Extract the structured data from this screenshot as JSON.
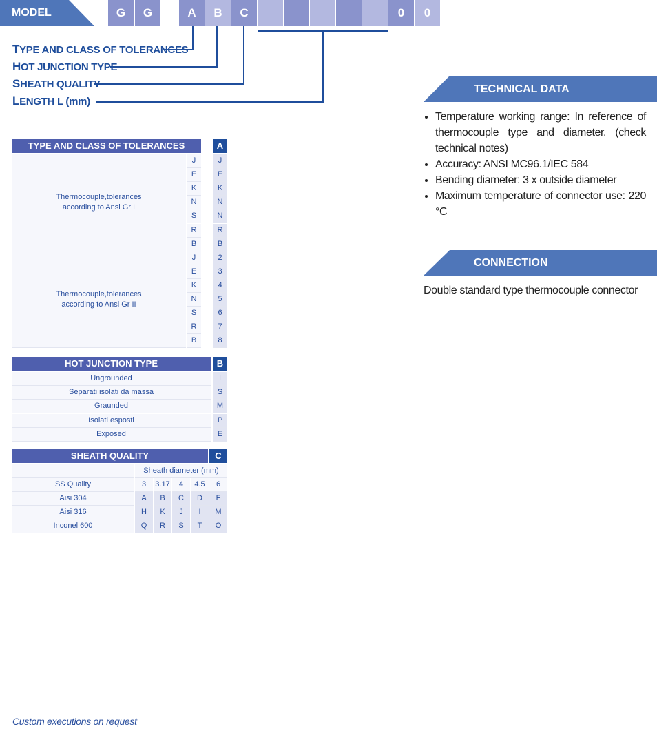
{
  "model": {
    "label": "MODEL",
    "boxes": [
      {
        "text": "G",
        "shade": "dark"
      },
      {
        "text": "G",
        "shade": "dark"
      },
      {
        "text": "A",
        "shade": "dark"
      },
      {
        "text": "B",
        "shade": "light"
      },
      {
        "text": "C",
        "shade": "dark"
      },
      {
        "text": "",
        "shade": "light"
      },
      {
        "text": "",
        "shade": "dark"
      },
      {
        "text": "",
        "shade": "light"
      },
      {
        "text": "",
        "shade": "dark"
      },
      {
        "text": "",
        "shade": "light"
      },
      {
        "text": "0",
        "shade": "dark"
      },
      {
        "text": "0",
        "shade": "light"
      }
    ],
    "legend": [
      {
        "first": "T",
        "rest": "YPE AND CLASS OF TOLERANCES"
      },
      {
        "first": "H",
        "rest": "OT JUNCTION TYPE"
      },
      {
        "first": "S",
        "rest": "HEATH QUALITY"
      },
      {
        "first": "L",
        "rest": "ENGTH L (mm)"
      }
    ]
  },
  "colors": {
    "banner": "#4f76b9",
    "header": "#4f5fae",
    "code_header": "#1f4e9c",
    "dark_box": "#8a93cc",
    "light_box": "#b3b8e0"
  },
  "table_a": {
    "title": "TYPE AND CLASS OF TOLERANCES",
    "code": "A",
    "groups": [
      {
        "label": "Thermocouple,tolerances\naccording to Ansi Gr I",
        "types": [
          "J",
          "E",
          "K",
          "N",
          "S",
          "R",
          "B"
        ],
        "codes": [
          "J",
          "E",
          "K",
          "N",
          "N",
          "R",
          "B"
        ]
      },
      {
        "label": "Thermocouple,tolerances\naccording to Ansi Gr II",
        "types": [
          "J",
          "E",
          "K",
          "N",
          "S",
          "R",
          "B"
        ],
        "codes": [
          "2",
          "3",
          "4",
          "5",
          "6",
          "7",
          "8"
        ]
      }
    ]
  },
  "table_b": {
    "title": "HOT JUNCTION TYPE",
    "code": "B",
    "rows": [
      {
        "label": "Ungrounded",
        "code": "I"
      },
      {
        "label": "Separati isolati da massa",
        "code": "S"
      },
      {
        "label": "Graunded",
        "code": "M"
      },
      {
        "label": "Isolati esposti",
        "code": "P"
      },
      {
        "label": "Exposed",
        "code": "E"
      }
    ]
  },
  "table_c": {
    "title": "SHEATH QUALITY",
    "code": "C",
    "subheader": "Sheath diameter (mm)",
    "row_header": "SS Quality",
    "diameters": [
      "3",
      "3.17",
      "4",
      "4.5",
      "6"
    ],
    "rows": [
      {
        "label": "Aisi 304",
        "codes": [
          "A",
          "B",
          "C",
          "D",
          "F"
        ]
      },
      {
        "label": "Aisi 316",
        "codes": [
          "H",
          "K",
          "J",
          "I",
          "M"
        ]
      },
      {
        "label": "Inconel 600",
        "codes": [
          "Q",
          "R",
          "S",
          "T",
          "O"
        ]
      }
    ]
  },
  "technical_data": {
    "title": "TECHNICAL DATA",
    "items": [
      "Temperature working range: In reference of thermocouple type and diameter. (check technical notes)",
      "Accuracy: ANSI MC96.1/IEC 584",
      "Bending diameter: 3 x outside diameter",
      "Maximum temperature of connector use: 220 °C"
    ]
  },
  "connection": {
    "title": "CONNECTION",
    "text": "Double standard type thermocouple connector"
  },
  "footer": "Custom executions on request"
}
